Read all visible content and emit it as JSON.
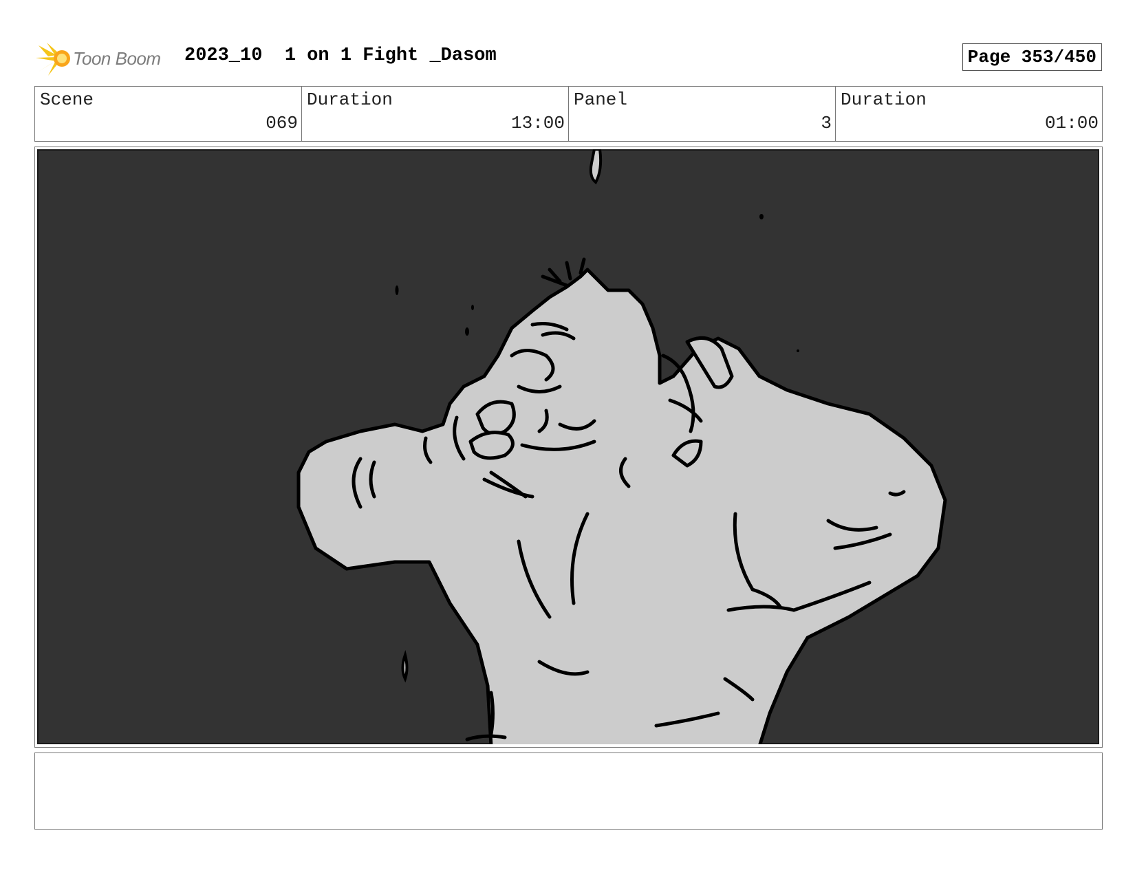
{
  "header": {
    "logo_text": "Toon Boom",
    "project_title": "2023_10  1 on 1 Fight _Dasom",
    "page_label": "Page 353/450"
  },
  "info": {
    "scene_label": "Scene",
    "scene_value": "069",
    "scene_duration_label": "Duration",
    "scene_duration_value": "13:00",
    "panel_label": "Panel",
    "panel_value": "3",
    "panel_duration_label": "Duration",
    "panel_duration_value": "01:00"
  },
  "panel": {
    "background_color": "#333333",
    "figure_fill": "#cccccc",
    "ink_color": "#000000"
  },
  "notes": {
    "text": ""
  }
}
